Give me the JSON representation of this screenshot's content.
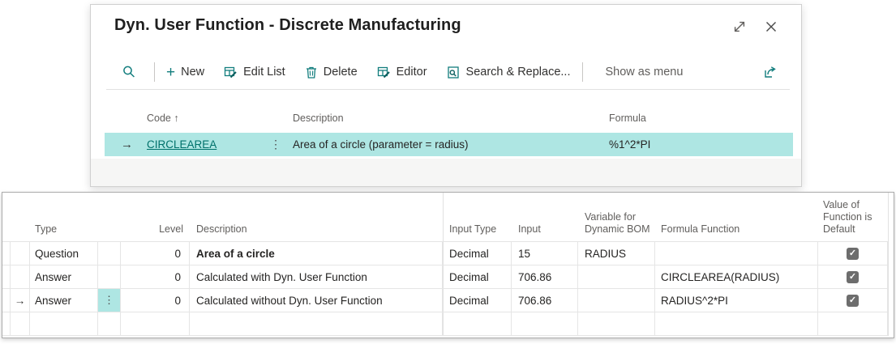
{
  "colors": {
    "accent_teal": "#127d7d",
    "link_teal": "#00716b",
    "selection_highlight": "#aee6e3",
    "header_text": "#605e5c",
    "body_text": "#252423",
    "checkbox_fill": "#6d6d6d"
  },
  "dialog": {
    "title": "Dyn. User Function - Discrete Manufacturing",
    "toolbar": {
      "new_label": "New",
      "new_glyph": "+",
      "edit_list_label": "Edit List",
      "delete_label": "Delete",
      "editor_label": "Editor",
      "search_replace_label": "Search & Replace...",
      "show_as_menu_label": "Show as menu"
    },
    "grid": {
      "headers": {
        "code": "Code",
        "sort_icon": "↑",
        "description": "Description",
        "formula": "Formula"
      },
      "selected_row": {
        "row_arrow": "→",
        "code": "CIRCLEAREA",
        "ellipsis": "⋮",
        "description": "Area of a circle (parameter = radius)",
        "formula": "%1^2*PI"
      }
    }
  },
  "worksheet": {
    "headers": {
      "type": "Type",
      "level": "Level",
      "description": "Description",
      "input_type": "Input Type",
      "input": "Input",
      "variable_for_dynamic_bom": "Variable for Dynamic BOM",
      "formula_function": "Formula Function",
      "value_of_function_is_default": "Value of Function is Default"
    },
    "rows": [
      {
        "type": "Question",
        "level": "0",
        "description": "Area of a circle",
        "input_type": "Decimal",
        "input": "15",
        "variable_for_dynamic_bom": "RADIUS",
        "formula_function": "",
        "default_checked": true
      },
      {
        "type": "Answer",
        "level": "0",
        "description": "Calculated with Dyn. User Function",
        "input_type": "Decimal",
        "input": "706.86",
        "variable_for_dynamic_bom": "",
        "formula_function": "CIRCLEAREA(RADIUS)",
        "default_checked": true
      },
      {
        "type": "Answer",
        "level": "0",
        "description": "Calculated without Dyn. User Function",
        "input_type": "Decimal",
        "input": "706.86",
        "variable_for_dynamic_bom": "",
        "formula_function": "RADIUS^2*PI",
        "default_checked": true,
        "row_arrow": "→",
        "ellipsis": "⋮"
      },
      {
        "type": "",
        "level": "",
        "description": "",
        "input_type": "",
        "input": "",
        "variable_for_dynamic_bom": "",
        "formula_function": "",
        "default_checked": false
      }
    ]
  }
}
